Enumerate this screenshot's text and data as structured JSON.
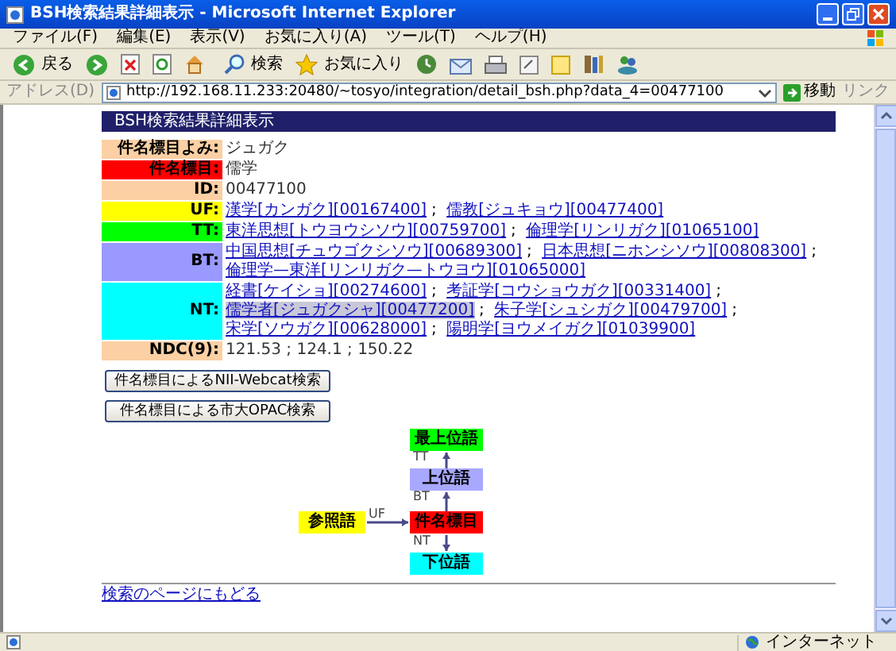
{
  "window": {
    "title": "BSH検索結果詳細表示 - Microsoft Internet Explorer"
  },
  "menu": [
    "ファイル(F)",
    "編集(E)",
    "表示(V)",
    "お気に入り(A)",
    "ツール(T)",
    "ヘルプ(H)"
  ],
  "toolbar": {
    "back": "戻る",
    "search": "検索",
    "favorites": "お気に入り"
  },
  "address": {
    "label": "アドレス(D)",
    "url": "http://192.168.11.233:20480/~tosyo/integration/detail_bsh.php?data_4=00477100",
    "go": "移動",
    "links": "リンク"
  },
  "page": {
    "heading": "BSH検索結果詳細表示",
    "fields": [
      {
        "label": "件名標目よみ:",
        "color": "#fcd0a4",
        "kind": "text",
        "value": "ジュガク"
      },
      {
        "label": "件名標目:",
        "color": "#ff0000",
        "kind": "text",
        "value": "儒学"
      },
      {
        "label": "ID:",
        "color": "#fcd0a4",
        "kind": "text",
        "value": "00477100"
      },
      {
        "label": "UF:",
        "color": "#ffff00",
        "kind": "links",
        "separator": ";",
        "links": [
          {
            "text": "漢学[カンガク][00167400]",
            "highlighted": false
          },
          {
            "text": "儒教[ジュキョウ][00477400]",
            "highlighted": false
          }
        ]
      },
      {
        "label": "TT:",
        "color": "#00ff00",
        "kind": "links",
        "separator": ";",
        "links": [
          {
            "text": "東洋思想[トウヨウシソウ][00759700]",
            "highlighted": false
          },
          {
            "text": "倫理学[リンリガク][01065100]",
            "highlighted": false
          }
        ]
      },
      {
        "label": "BT:",
        "color": "#9999ff",
        "kind": "links",
        "separator": ";",
        "links": [
          {
            "text": "中国思想[チュウゴクシソウ][00689300]",
            "highlighted": false
          },
          {
            "text": "日本思想[ニホンシソウ][00808300]",
            "highlighted": false
          },
          {
            "text": "倫理学—東洋[リンリガク—トウヨウ][01065000]",
            "highlighted": false
          }
        ]
      },
      {
        "label": "NT:",
        "color": "#00ffff",
        "kind": "links",
        "separator": ";",
        "links": [
          {
            "text": "経書[ケイショ][00274600]",
            "highlighted": false
          },
          {
            "text": "考証学[コウショウガク][00331400]",
            "highlighted": false
          },
          {
            "text": "儒学者[ジュガクシャ][00477200]",
            "highlighted": true
          },
          {
            "text": "朱子学[シュシガク][00479700]",
            "highlighted": false
          },
          {
            "text": "宋学[ソウガク][00628000]",
            "highlighted": false
          },
          {
            "text": "陽明学[ヨウメイガク][01039900]",
            "highlighted": false
          }
        ]
      },
      {
        "label": "NDC(9):",
        "color": "#fcd0a4",
        "kind": "text",
        "value": "121.53 ; 124.1 ; 150.22"
      }
    ],
    "buttons": [
      "件名標目によるNII-Webcat検索",
      "件名標目による市大OPAC検索"
    ],
    "diagram": {
      "nodes": [
        {
          "label": "最上位語",
          "color": "#00ff00"
        },
        {
          "label": "上位語",
          "color": "#a8a8ff"
        },
        {
          "label": "参照語",
          "color": "#ffff00"
        },
        {
          "label": "件名標目",
          "color": "#ff0000"
        },
        {
          "label": "下位語",
          "color": "#00ffff"
        }
      ],
      "edges": [
        {
          "label": "TT"
        },
        {
          "label": "BT"
        },
        {
          "label": "UF"
        },
        {
          "label": "NT"
        }
      ]
    },
    "back_link": "検索のページにもどる"
  },
  "status_bar": {
    "zone": "インターネット"
  }
}
